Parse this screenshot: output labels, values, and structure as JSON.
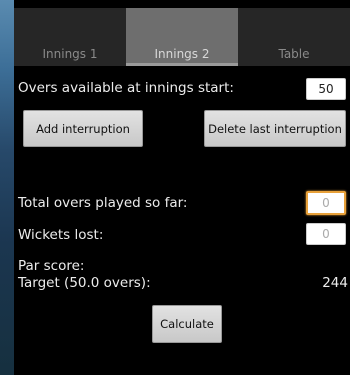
{
  "tabs": [
    {
      "label": "Innings 1",
      "active": false
    },
    {
      "label": "Innings 2",
      "active": true
    },
    {
      "label": "Table",
      "active": false
    }
  ],
  "form": {
    "overs_label": "Overs available at innings start:",
    "overs_value": "50",
    "add_interruption_label": "Add interruption",
    "delete_interruption_label": "Delete last interruption",
    "total_overs_label": "Total overs played so far:",
    "total_overs_value": "0",
    "wickets_label": "Wickets lost:",
    "wickets_value": "0",
    "par_score_label": "Par score:",
    "target_label": "Target (50.0 overs):",
    "target_value": "244",
    "calculate_label": "Calculate"
  },
  "colors": {
    "active_tab": "#6e6e6e",
    "focus_border": "#e8a13a"
  }
}
